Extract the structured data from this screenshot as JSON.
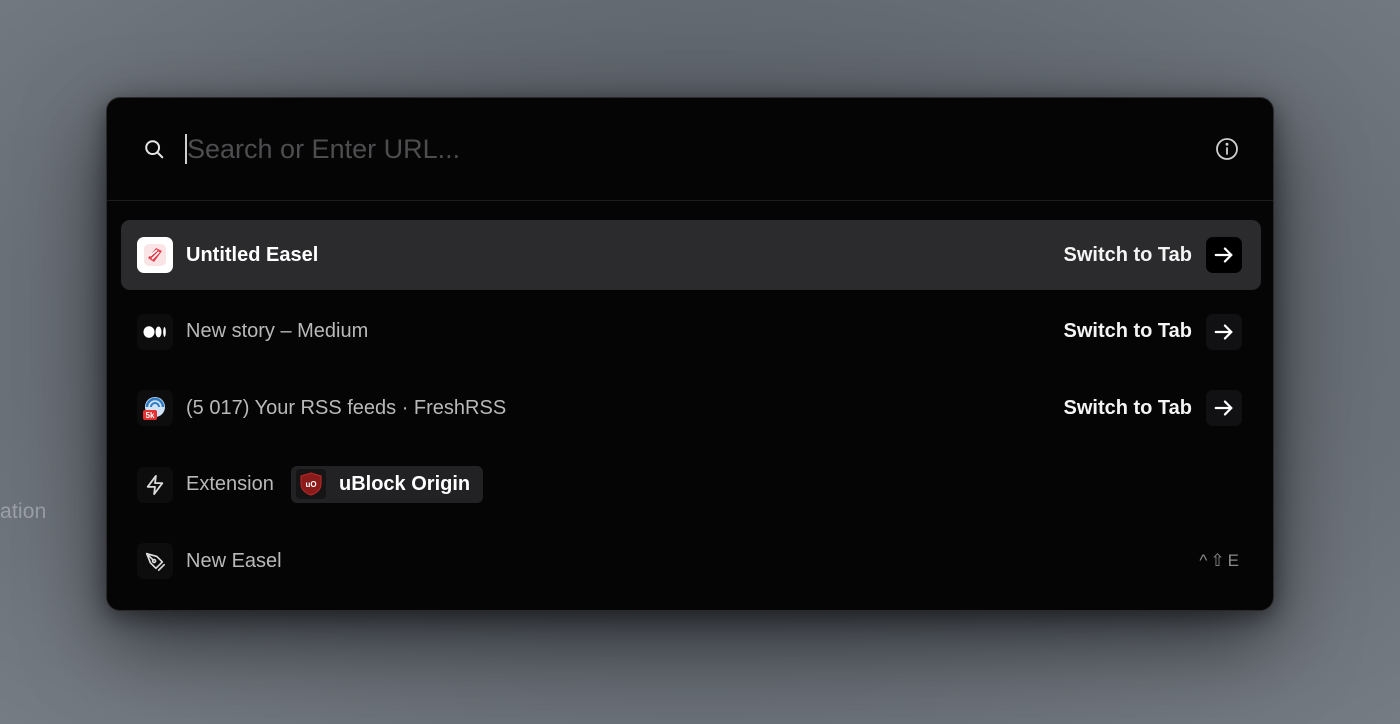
{
  "background": {
    "partial_text": "ation"
  },
  "search": {
    "placeholder": "Search or Enter URL...",
    "value": ""
  },
  "results": [
    {
      "title": "Untitled Easel",
      "action": "Switch to Tab",
      "icon": "easel-app-icon",
      "selected": true
    },
    {
      "title": "New story – Medium",
      "action": "Switch to Tab",
      "icon": "medium-icon",
      "selected": false
    },
    {
      "title": "(5 017) Your RSS feeds · FreshRSS",
      "action": "Switch to Tab",
      "icon": "freshrss-icon",
      "selected": false
    }
  ],
  "extension_row": {
    "label": "Extension",
    "chip_label": "uBlock Origin",
    "chip_icon": "ublock-origin-icon"
  },
  "command_row": {
    "label": "New Easel",
    "icon": "pen-tool-icon",
    "shortcut_keys": [
      "^",
      "⇧",
      "E"
    ]
  },
  "icon_badge_text": "5k",
  "ublock_logo_text": "uO",
  "colors": {
    "palette_bg": "#050505",
    "selected_row_bg": "#2b2b2d",
    "placeholder": "#4d4d50",
    "ublock_red": "#8b1a1a",
    "easel_red": "#e0424e"
  }
}
